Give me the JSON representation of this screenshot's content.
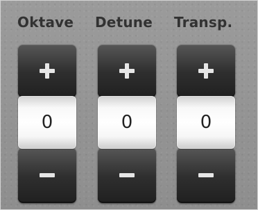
{
  "controls": [
    {
      "label": "Oktave",
      "value": "0",
      "plus_icon": "plus-icon",
      "minus_icon": "minus-icon"
    },
    {
      "label": "Detune",
      "value": "0",
      "plus_icon": "plus-icon",
      "minus_icon": "minus-icon"
    },
    {
      "label": "Transp.",
      "value": "0",
      "plus_icon": "plus-icon",
      "minus_icon": "minus-icon"
    }
  ],
  "colors": {
    "panel_background": "#939393",
    "label_text": "#323232",
    "button_dark": "#2f2f2f",
    "button_symbol": "#e6e6e6",
    "value_box": "#f7f7f7",
    "value_text": "#232323"
  }
}
